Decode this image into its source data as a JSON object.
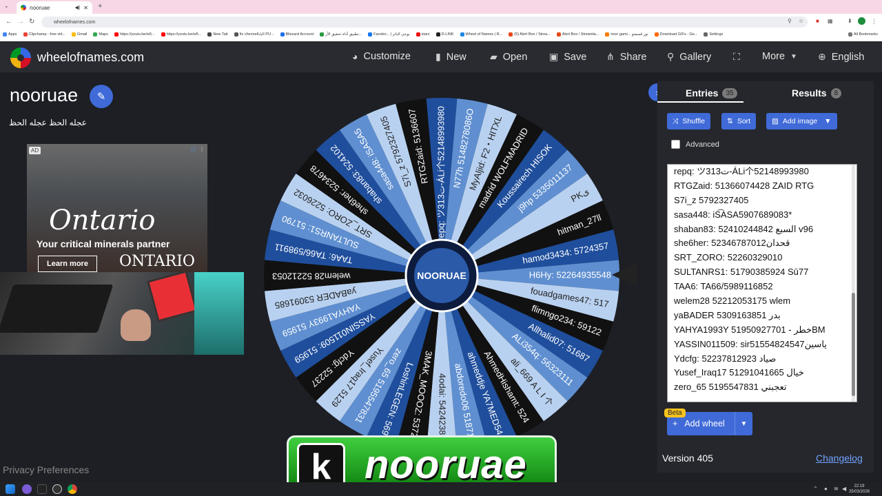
{
  "browser": {
    "tab_title": "nooruae",
    "url": "wheelofnames.com",
    "bookmarks": [
      "Apps",
      "Clipchamp - free vid...",
      "Gmail",
      "Maps",
      "https://youtu.be/w5...",
      "https://youtu.be/w5...",
      "New Tab",
      "fix chennelالبابا PU...",
      "Blizzard Account",
      "تطبيق أداة تحقيق الأر...",
      "Facebo... | بوجي الباتر",
      "starz",
      "D-LINK",
      "Wheel of Names | R...",
      "(5) Alert Box / Strea...",
      "Alert Box / Streamla...",
      "noor gami... نور قسمتو",
      "Download GIFs - Ge...",
      "Settings",
      "All Bookmarks"
    ]
  },
  "topbar": {
    "site_name": "wheelofnames.com",
    "customize": "Customize",
    "new": "New",
    "open": "Open",
    "save": "Save",
    "share": "Share",
    "gallery": "Gallery",
    "more": "More",
    "language": "English"
  },
  "wheel_info": {
    "title": "nooruae",
    "description": "عجله الحظ عجله الحظ"
  },
  "ad": {
    "label": "AD",
    "headline": "Ontario",
    "sub": "Your critical minerals partner",
    "cta": "Learn more",
    "brand": "ONTARIO"
  },
  "privacy": "Privacy Preferences",
  "wheel_slices": [
    "repq: ツ313ت-ÁLi个52148993980",
    "N77h 5148278086O",
    "MyAljid: F2・HITXL",
    "madrid WOLFMADRID",
    "Koussairech HISOK",
    "j9hp 5335011137",
    "PKی",
    "hitman_27ll",
    "hamod3434: 5724357",
    "H6Hy: 52264935548",
    "fouadgames47: 517",
    "flimngo234: 59122",
    "Allhalid07: 51687",
    "ALi354q: 56323111",
    "ali_669 A L I 个",
    "AhmedHishamt: 524",
    "ahmeddje YA7MED54",
    "abdoredo06 518719",
    "4odai: 542423809",
    "3MAK_MOOOZ: 53725",
    "LoshinLEGEN: 569",
    "zero_65 5195547831",
    "Yusef_Iraq17 5129",
    "Ydcfg: 52237",
    "YASSIN011509: 51959",
    "YAHYA1993Y 51959",
    "yaBADER 53091685",
    "welem28 52212053",
    "TAA6: TA66/598911",
    "SULTANRS1: 51790",
    "SRT_ZORO: 5226032",
    "she6her: 5234678",
    "shaban83: 524102",
    "sasa448: iSASA5",
    "S7i_z 5792327405",
    "RTGZaid: 5136607"
  ],
  "panel": {
    "entries_tab": "Entries",
    "entries_count": "35",
    "results_tab": "Results",
    "results_count": "8",
    "shuffle": "Shuffle",
    "sort": "Sort",
    "add_image": "Add image",
    "advanced": "Advanced",
    "entries": [
      "repq: ツ313ت-ÁLi个52148993980",
      "RTGZaid: 51366074428 ZAID RTG",
      "S7i_z 5792327405",
      "sasa448: iS͡ASA5907689083*",
      "shaban83: 52410244842 السبع v96",
      "she6her: 52346787012قحدان",
      "SRT_ZORO: 52260329010",
      "SULTANRS1: 51790385924 Sū77",
      "TAA6: TA66/5989116852",
      "welem28 52212053175 wlem",
      "yaBADER 5309163851 بدر",
      "YAHYA1993Y 51950927701 - خطرBM",
      "YASSIN011509: sir51554824547ياسين",
      "Ydcfg: 52237812923 صياد",
      "Yusef_Iraq17 51291041665 خيال",
      "zero_65 5195547831 تعجبني"
    ],
    "beta": "Beta",
    "add_wheel": "Add wheel",
    "version": "Version 405",
    "changelog": "Changelog"
  },
  "overlay_logo": {
    "letter": "k",
    "text": "nooruae"
  },
  "center_label": "NOORUAE",
  "taskbar": {
    "time": "22:19",
    "date": "25/03/2026"
  },
  "colors": {
    "accent": "#3f6ad8",
    "wheel_a": "#1f4e9c",
    "wheel_b": "#5f8fd0",
    "wheel_c": "#b9d1f0",
    "wheel_d": "#111111",
    "bg": "#1d1f24"
  }
}
